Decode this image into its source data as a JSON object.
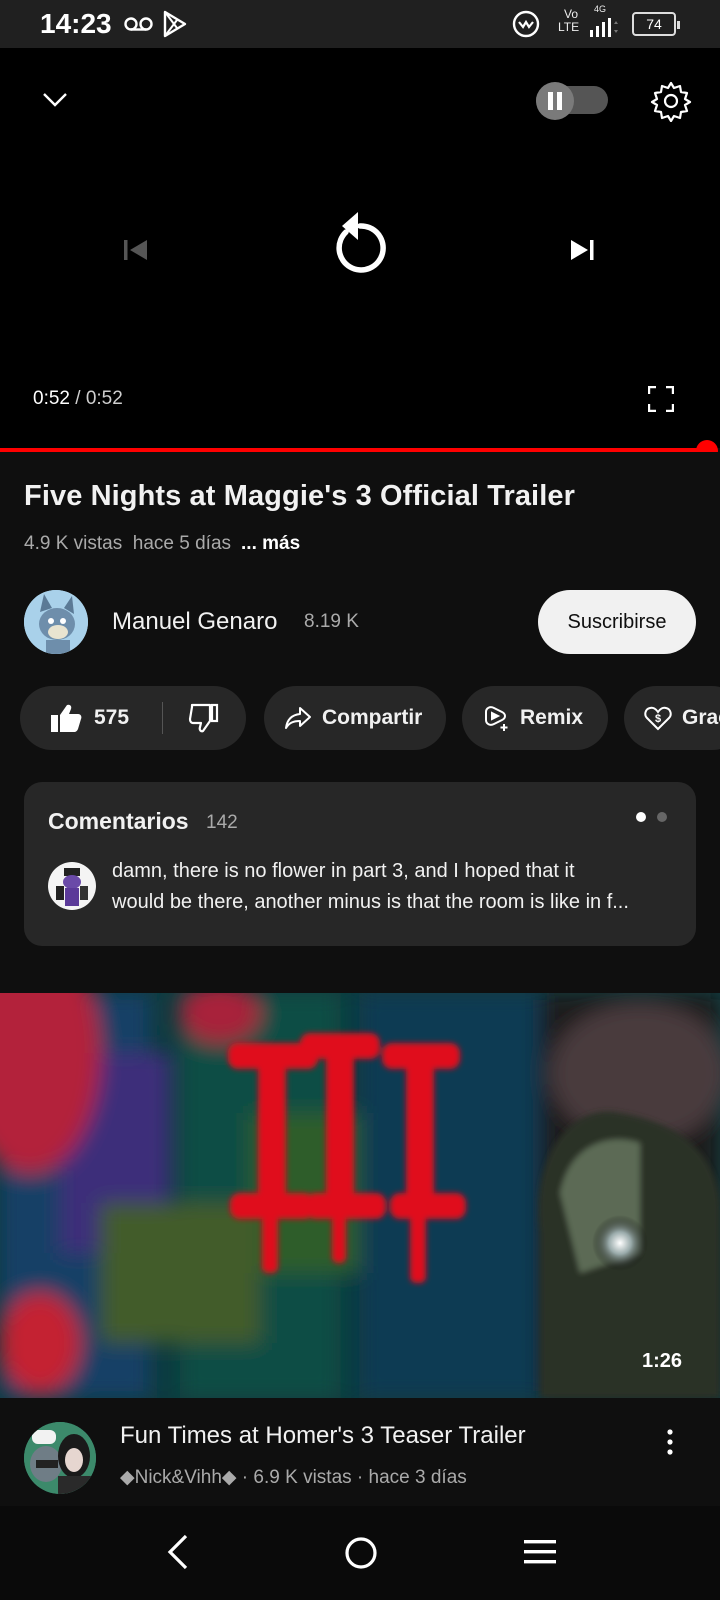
{
  "status_bar": {
    "time": "14:23",
    "network_small": "4G",
    "lte_line1": "Vo",
    "lte_line2": "LTE",
    "battery": "74",
    "icons": [
      "voicemail-icon",
      "play-store-icon",
      "hotspot-icon",
      "signal-icon",
      "battery-icon"
    ]
  },
  "player": {
    "time_current": "0:52",
    "time_separator": " / ",
    "time_total": "0:52",
    "progress_fraction": 1.0,
    "autoplay_state": "paused",
    "icons": [
      "chevron-down-icon",
      "pause-icon",
      "settings-gear-icon",
      "previous-icon",
      "replay-icon",
      "next-icon",
      "fullscreen-icon"
    ]
  },
  "video": {
    "title": "Five Nights at Maggie's 3 Official Trailer",
    "views": "4.9 K vistas",
    "age": "hace 5 días",
    "more": "... más"
  },
  "channel": {
    "name": "Manuel Genaro",
    "subscribers": "8.19 K",
    "subscribe_label": "Suscribirse"
  },
  "actions": {
    "likes": "575",
    "share_label": "Compartir",
    "remix_label": "Remix",
    "thanks_label": "Grac"
  },
  "comments": {
    "title": "Comentarios",
    "count": "142",
    "top_comment_line1": "damn, there is no flower in part 3, and I hoped that it",
    "top_comment_line2": "would be there, another minus is that the room is like in f..."
  },
  "next_video": {
    "duration": "1:26",
    "title": "Fun Times at Homer's 3 Teaser Trailer",
    "channel": "◆Nick&Vihh◆",
    "views": "6.9 K vistas",
    "age": "hace 3 días",
    "meta_separator": " · "
  },
  "colors": {
    "background": "#0f0f0f",
    "card": "#272727",
    "accent_red": "#ff0000",
    "subscribe_bg": "#f1f1f1",
    "secondary_text": "#aaaaaa"
  }
}
